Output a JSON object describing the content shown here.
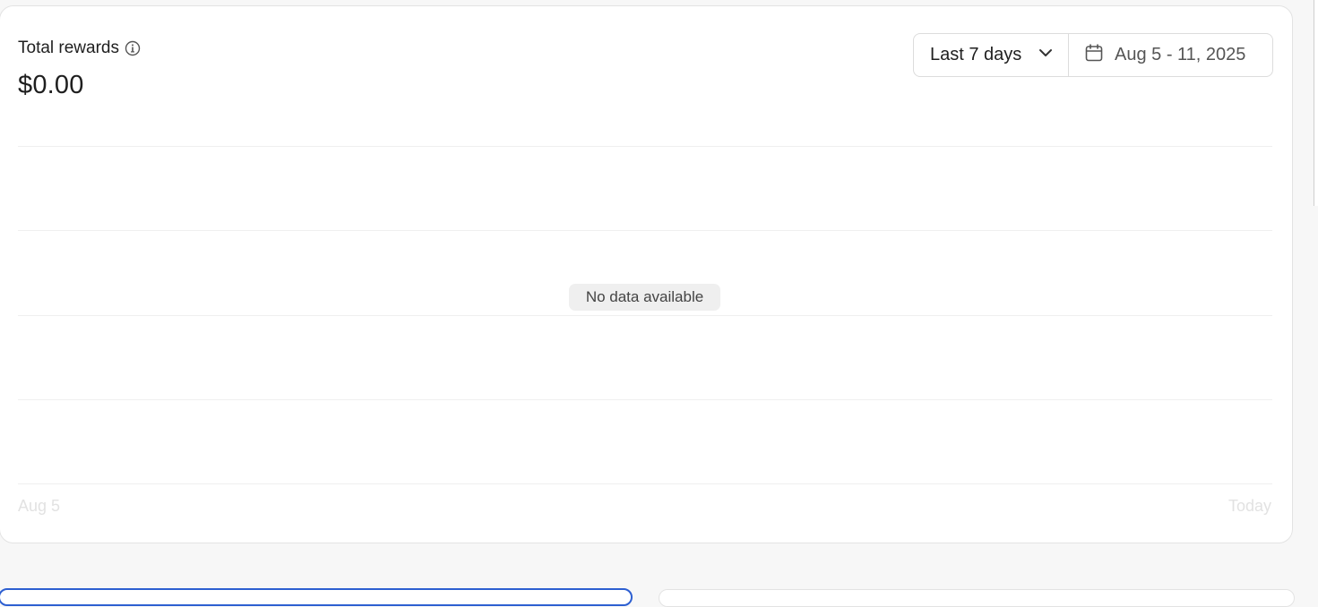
{
  "rewards_card": {
    "title": "Total rewards",
    "amount": "$0.00",
    "info_icon": "info-icon"
  },
  "filters": {
    "range_label": "Last 7 days",
    "range_icon": "chevron-down-icon",
    "date_range": "Aug 5 - 11, 2025",
    "date_icon": "calendar-icon"
  },
  "chart": {
    "empty_message": "No data available",
    "x_start_label": "Aug 5",
    "x_end_label": "Today"
  },
  "chart_data": {
    "type": "line",
    "title": "Total rewards",
    "x": [],
    "series": [],
    "xlabel": "",
    "ylabel": "",
    "tick_labels_x": [
      "Aug 5",
      "Today"
    ],
    "grid": true,
    "annotation": "No data available"
  },
  "colors": {
    "accent": "#2d5fd1",
    "card_bg": "#ffffff",
    "page_bg": "#f7f7f7"
  }
}
